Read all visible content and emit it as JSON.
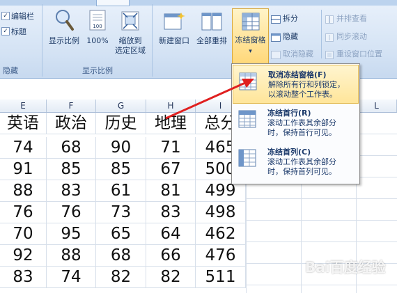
{
  "ribbon": {
    "show_hide_group": {
      "label": "隐藏",
      "items": [
        {
          "label": "编辑栏",
          "checked": true
        },
        {
          "label": "标题",
          "checked": true
        }
      ]
    },
    "zoom_group": {
      "label": "显示比例",
      "buttons": [
        {
          "label": "显示比例",
          "icon": "magnifier-icon"
        },
        {
          "label": "100%",
          "icon": "page-100-icon"
        },
        {
          "label_line1": "缩放到",
          "label_line2": "选定区域",
          "icon": "zoom-selection-icon"
        }
      ]
    },
    "window_group": {
      "new_window": "新建窗口",
      "arrange_all": "全部重排",
      "freeze_panes": "冻结窗格",
      "freeze_arrow": "▾",
      "split": "拆分",
      "hide": "隐藏",
      "unhide": "取消隐藏",
      "side_by_side": "并排查看",
      "sync_scroll": "同步滚动",
      "reset_position": "重设窗口位置"
    }
  },
  "grid": {
    "columns": [
      "E",
      "F",
      "G",
      "H",
      "I",
      "",
      "L"
    ],
    "header_row": [
      "英语",
      "政治",
      "历史",
      "地理",
      "总分"
    ],
    "rows": [
      [
        "74",
        "68",
        "90",
        "71",
        "465"
      ],
      [
        "91",
        "85",
        "85",
        "67",
        "500"
      ],
      [
        "88",
        "83",
        "61",
        "81",
        "499"
      ],
      [
        "76",
        "76",
        "73",
        "83",
        "498"
      ],
      [
        "70",
        "95",
        "65",
        "64",
        "462"
      ],
      [
        "92",
        "88",
        "68",
        "66",
        "476"
      ],
      [
        "83",
        "74",
        "82",
        "82",
        "511"
      ]
    ]
  },
  "dropdown": {
    "items": [
      {
        "title": "取消冻结窗格(F)",
        "desc_line1": "解除所有行和列锁定，",
        "desc_line2": "以滚动整个工作表。",
        "highlighted": true
      },
      {
        "title": "冻结首行(R)",
        "desc_line1": "滚动工作表其余部分",
        "desc_line2": "时，保持首行可见。",
        "highlighted": false
      },
      {
        "title": "冻结首列(C)",
        "desc_line1": "滚动工作表其余部分",
        "desc_line2": "时，保持首列可见。",
        "highlighted": false
      }
    ]
  },
  "watermark": "Bai百度经验",
  "colors": {
    "annotation_arrow": "#e02020",
    "highlight": "#ffe59a"
  }
}
